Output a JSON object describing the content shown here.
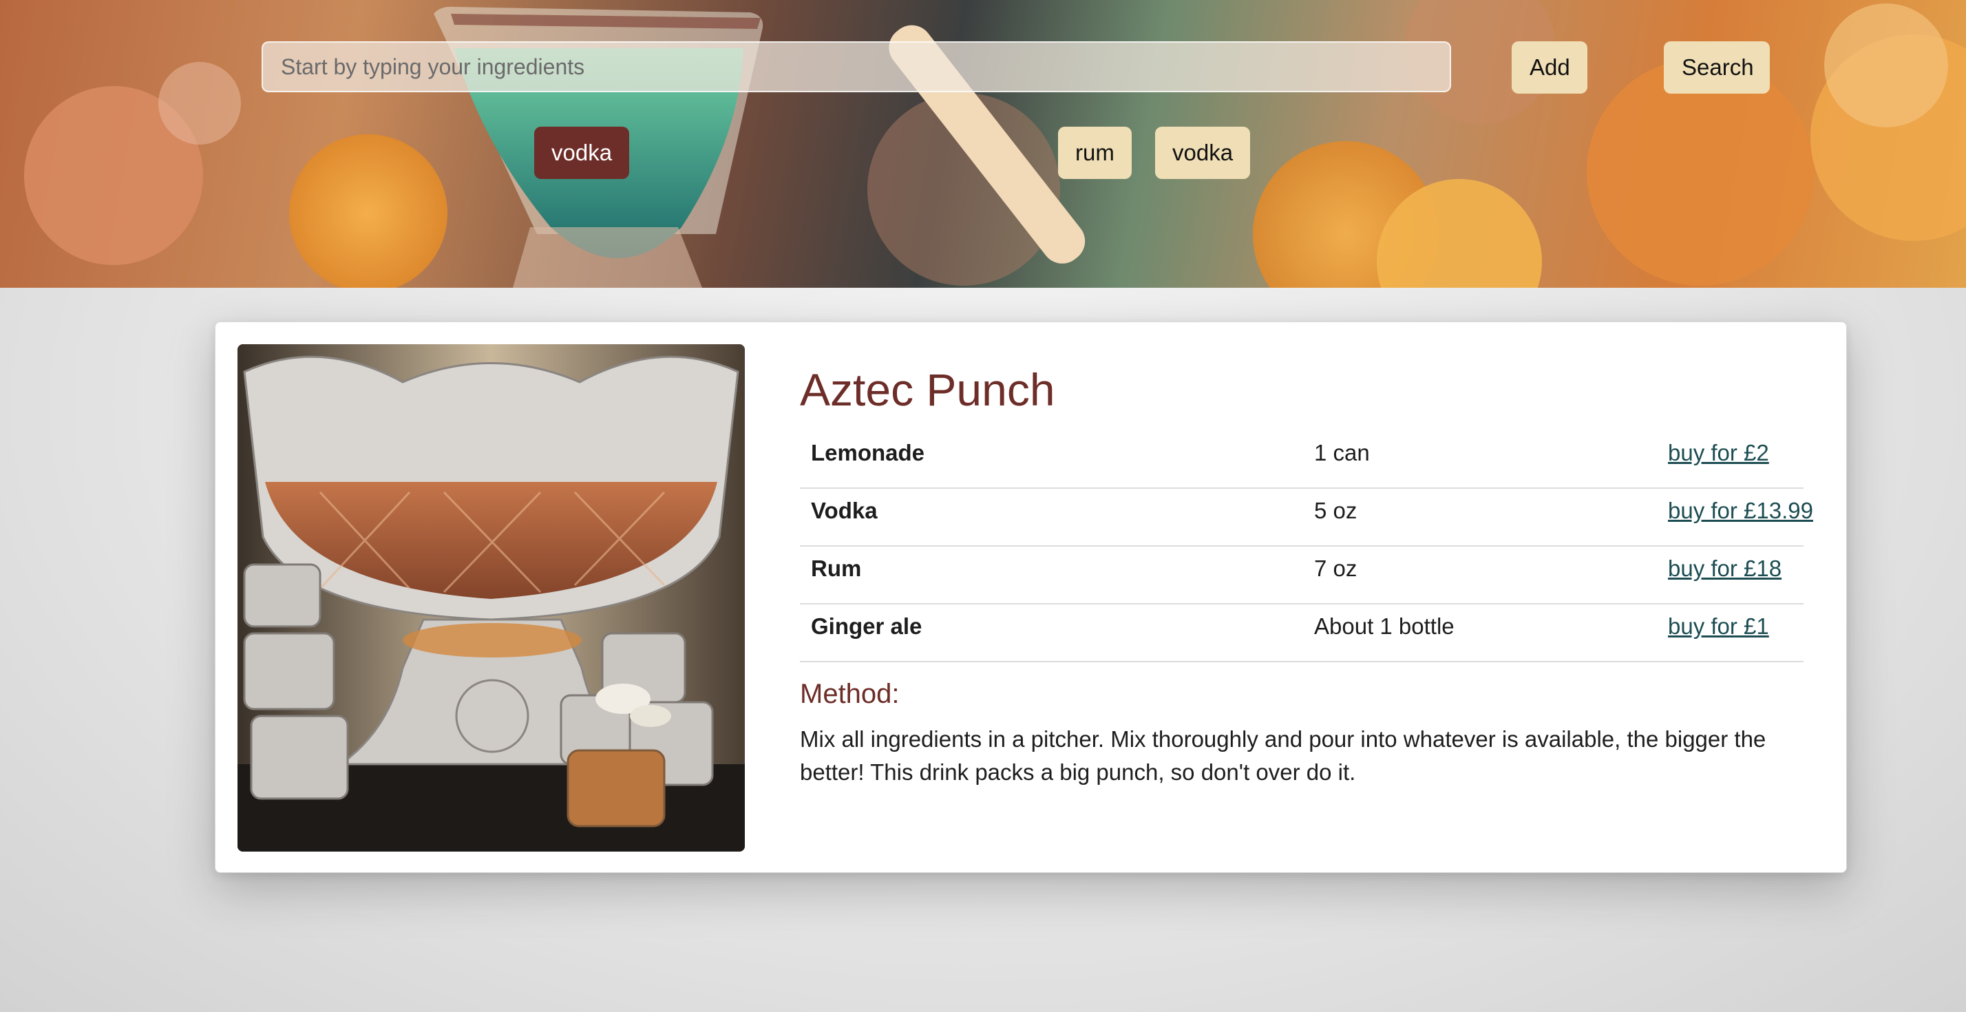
{
  "header": {
    "search": {
      "placeholder": "Start by typing your ingredients",
      "value": ""
    },
    "add_label": "Add",
    "search_label": "Search",
    "selected_ingredient": "vodka",
    "ingredient_chips": [
      "rum",
      "vodka"
    ],
    "background_icon": "cocktail-glass-illustration"
  },
  "recipe": {
    "image_icon": "punch-bowl-photo",
    "title": "Aztec Punch",
    "ingredients": [
      {
        "name": "Lemonade",
        "quantity": "1 can",
        "buy": "buy for £2"
      },
      {
        "name": "Vodka",
        "quantity": "5 oz",
        "buy": "buy for £13.99"
      },
      {
        "name": "Rum",
        "quantity": "7 oz",
        "buy": "buy for £18"
      },
      {
        "name": "Ginger ale",
        "quantity": "About 1 bottle",
        "buy": "buy for £1"
      }
    ],
    "method_heading": "Method:",
    "method_text": "Mix all ingredients in a pitcher. Mix thoroughly and pour into whatever is available, the bigger the better! This drink packs a big punch, so don't over do it."
  },
  "colors": {
    "accent": "#6d2d28",
    "chip": "#f0dfb6",
    "link": "#1c4d52"
  }
}
